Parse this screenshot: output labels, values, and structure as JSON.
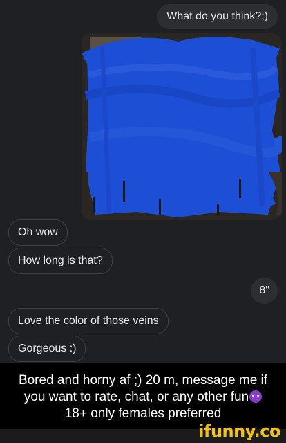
{
  "messages": {
    "question": "What do you think?;)",
    "oh_wow": "Oh wow",
    "how_long": "How long is that?",
    "answer": "8\"",
    "love_color": "Love the color of those veins",
    "gorgeous": "Gorgeous :)"
  },
  "photo": {
    "icon": "censored-photo",
    "scribble_color": "#1c4fd6"
  },
  "caption": {
    "line1": "Bored and horny af ;) 20 m, message me if",
    "line2": "you want to rate, chat, or any other fun",
    "line3": "18+ only females preferred",
    "emoji": "smiling-devil-emoji"
  },
  "watermark": "ifunny.co",
  "colors": {
    "background": "#1f2023",
    "bubble_out": "#2d2e31",
    "bubble_in_border": "#3e3f43",
    "caption_bg": "#000000",
    "watermark": "#f2c211"
  }
}
